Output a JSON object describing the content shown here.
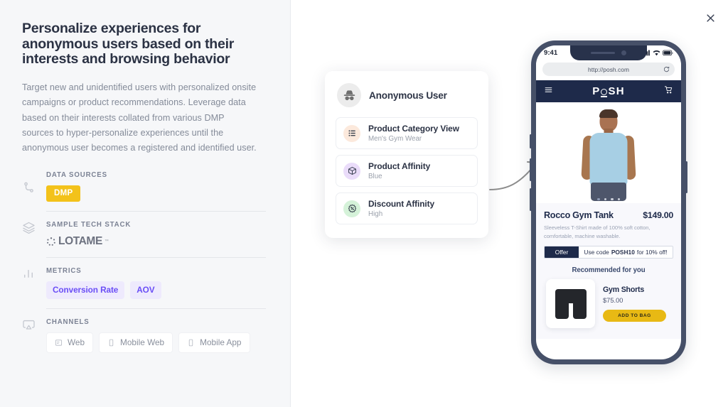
{
  "sidebar": {
    "headline": "Personalize experiences for anonymous users based on their interests and browsing behavior",
    "body": "Target new and unidentified users with personalized onsite campaigns or product recommendations. Leverage data based on their interests collated from various DMP sources to hyper-personalize experiences until the anonymous user becomes a registered and identified user.",
    "sections": [
      {
        "label": "DATA SOURCES",
        "icon": "data-flow-icon",
        "items": [
          "DMP"
        ]
      },
      {
        "label": "SAMPLE TECH STACK",
        "icon": "layers-icon",
        "items": [
          "LOTAME"
        ]
      },
      {
        "label": "METRICS",
        "icon": "bar-chart-icon",
        "items": [
          "Conversion Rate",
          "AOV"
        ]
      },
      {
        "label": "CHANNELS",
        "icon": "airplay-icon",
        "items": [
          "Web",
          "Mobile Web",
          "Mobile App"
        ]
      }
    ],
    "tech_logo_text": "LOTAME",
    "tech_logo_tm": "™"
  },
  "main": {
    "close_icon": "close-icon",
    "anon_card": {
      "avatar_icon": "incognito-icon",
      "title": "Anonymous User",
      "attributes": [
        {
          "icon": "list-icon",
          "title": "Product Category View",
          "value": "Men's Gym Wear"
        },
        {
          "icon": "box-icon",
          "title": "Product Affinity",
          "value": "Blue"
        },
        {
          "icon": "discount-tag-icon",
          "title": "Discount Affinity",
          "value": "High"
        }
      ]
    },
    "phone": {
      "status_time": "9:41",
      "status_icons": [
        "signal-icon",
        "wifi-icon",
        "battery-icon"
      ],
      "url": "http://posh.com",
      "reload_icon": "reload-icon",
      "menu_icon": "hamburger-menu-icon",
      "brand": "POSH",
      "cart_icon": "shopping-cart-icon",
      "carousel_dots": 4,
      "carousel_active": 1,
      "product": {
        "name": "Rocco Gym Tank",
        "price": "$149.00",
        "description": "Sleeveless T-Shirt made of 100% soft cotton, comfortable, machine washable."
      },
      "offer": {
        "tag": "Offer",
        "prefix": "Use code",
        "code": "POSH10",
        "suffix": "for 10% off!"
      },
      "recommended": {
        "heading": "Recommended for you",
        "name": "Gym Shorts",
        "price": "$75.00",
        "cta": "ADD TO BAG"
      }
    }
  },
  "colors": {
    "sidebar_bg": "#f6f7f9",
    "headline": "#2b3244",
    "badge_dmp": "#f3c21a",
    "metric_chip_bg": "#eeeafd",
    "metric_chip_text": "#6a4ef6",
    "phone_frame": "#465068",
    "site_nav": "#1e2a4a",
    "cta": "#e8b914"
  }
}
